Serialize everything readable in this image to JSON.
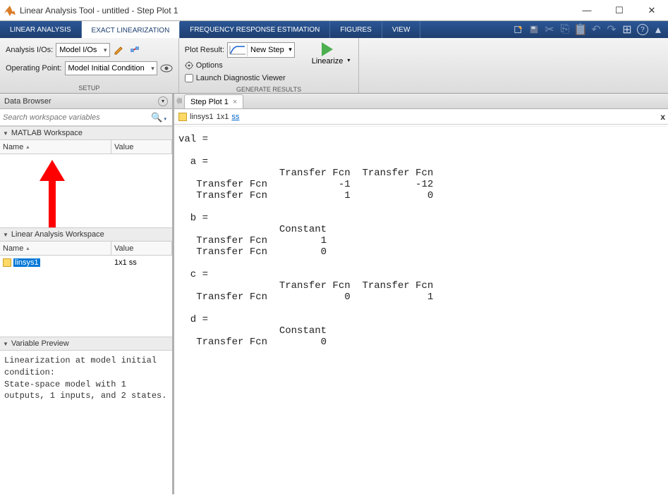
{
  "window": {
    "title": "Linear Analysis Tool - untitled - Step Plot 1"
  },
  "tabs": {
    "linear": "LINEAR ANALYSIS",
    "exact": "EXACT LINEARIZATION",
    "freq": "FREQUENCY RESPONSE ESTIMATION",
    "figures": "FIGURES",
    "view": "VIEW"
  },
  "ribbon": {
    "analysis_io_label": "Analysis I/Os:",
    "analysis_io_value": "Model I/Os",
    "operating_point_label": "Operating Point:",
    "operating_point_value": "Model Initial Condition",
    "setup_group": "SETUP",
    "plot_result_label": "Plot Result:",
    "plot_result_value": "New Step",
    "options": "Options",
    "launch_diag": "Launch Diagnostic Viewer",
    "linearize": "Linearize",
    "generate_group": "GENERATE RESULTS"
  },
  "left": {
    "data_browser": "Data Browser",
    "search_placeholder": "Search workspace variables",
    "matlab_ws": "MATLAB Workspace",
    "col_name": "Name",
    "col_value": "Value",
    "la_ws": "Linear Analysis Workspace",
    "la_row": {
      "name": "linsys1",
      "value": "1x1 ss"
    },
    "var_preview": "Variable Preview",
    "preview_text": "Linearization at model initial condition:\nState-space model with 1 outputs, 1 inputs, and 2 states."
  },
  "right": {
    "tab_label": "Step Plot 1",
    "info_name": "linsys1",
    "info_dim": "1x1",
    "info_type": "ss",
    "output": "val =\n\n  a = \n                 Transfer Fcn  Transfer Fcn\n   Transfer Fcn            -1           -12\n   Transfer Fcn             1             0\n \n  b = \n                 Constant\n   Transfer Fcn         1\n   Transfer Fcn         0\n \n  c = \n                 Transfer Fcn  Transfer Fcn\n   Transfer Fcn             0             1\n \n  d = \n                 Constant\n   Transfer Fcn         0\n "
  }
}
